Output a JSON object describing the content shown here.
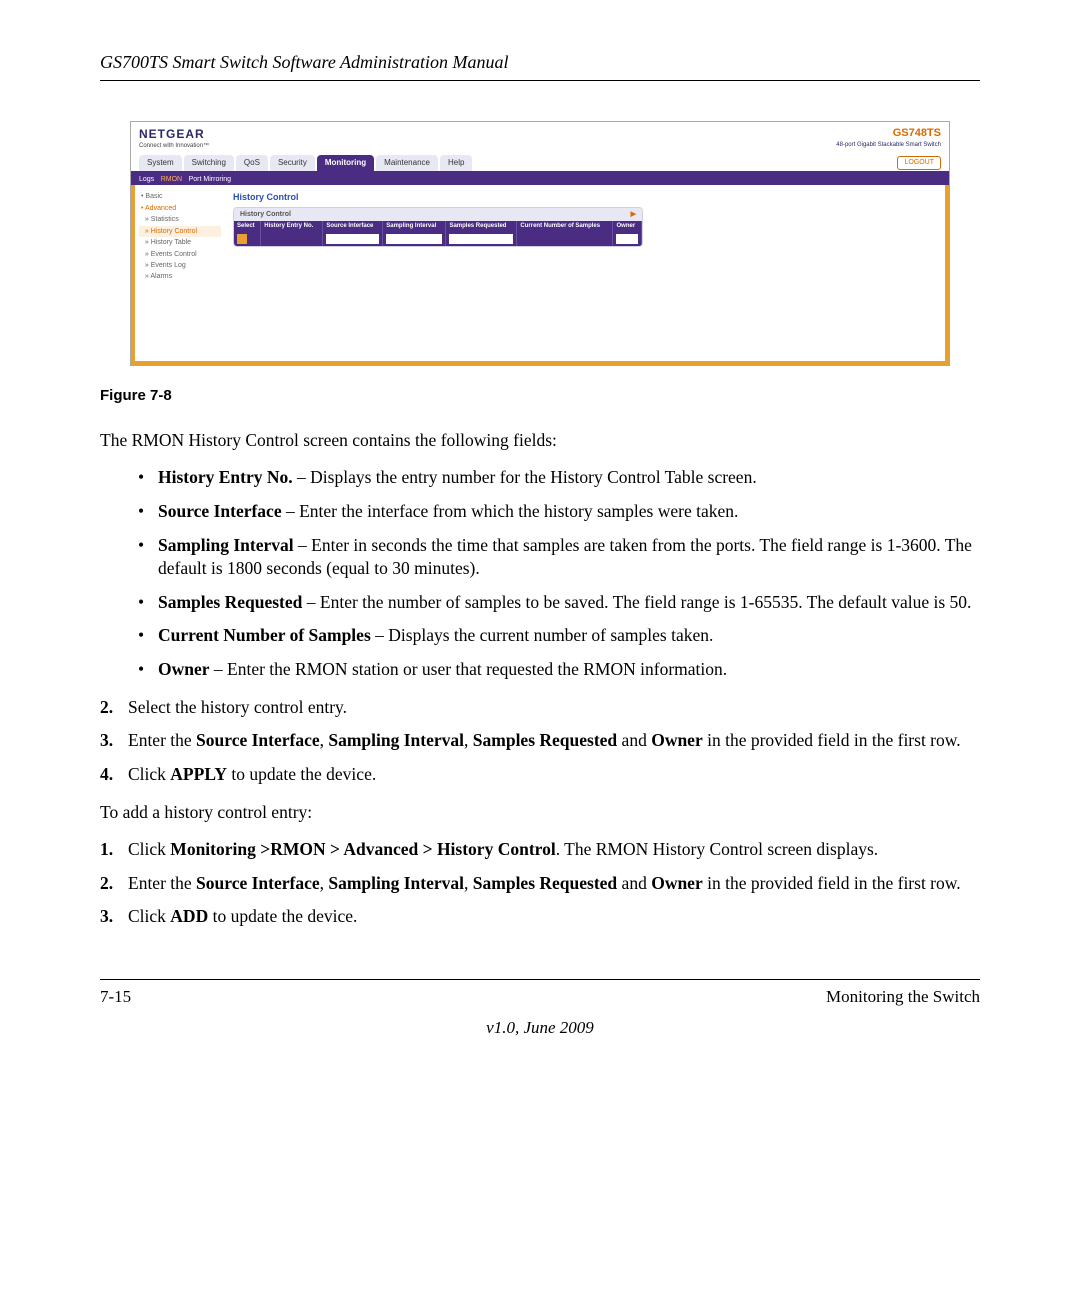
{
  "header": {
    "title": "GS700TS Smart Switch Software Administration Manual"
  },
  "screenshot": {
    "brand": "NETGEAR",
    "brand_tagline": "Connect with Innovation™",
    "model": "GS748TS",
    "model_tagline": "48-port Gigabit Stackable Smart Switch",
    "tabs": [
      "System",
      "Switching",
      "QoS",
      "Security",
      "Monitoring",
      "Maintenance",
      "Help"
    ],
    "active_tab": "Monitoring",
    "logout": "LOGOUT",
    "subtabs": [
      "Logs",
      "RMON",
      "Port Mirroring"
    ],
    "active_subtab": "RMON",
    "side_items": [
      "Basic",
      "Advanced",
      "Statistics",
      "History Control",
      "History Table",
      "Events Control",
      "Events Log",
      "Alarms"
    ],
    "side_active": "History Control",
    "section_title": "History Control",
    "panel_title": "History Control",
    "table_headers": [
      "Select",
      "History Entry No.",
      "Source Interface",
      "Sampling Interval",
      "Samples Requested",
      "Current Number of Samples",
      "Owner"
    ]
  },
  "figure_caption": "Figure 7-8",
  "intro": "The RMON History Control screen contains the following fields:",
  "fields": [
    {
      "term": "History Entry No.",
      "desc": " – Displays the entry number for the History Control Table screen."
    },
    {
      "term": "Source Interface",
      "desc": " – Enter the interface from which the history samples were taken."
    },
    {
      "term": "Sampling Interval",
      "desc": " – Enter in seconds the time that samples are taken from the ports. The field range is 1-3600. The default is 1800 seconds (equal to 30 minutes)."
    },
    {
      "term": "Samples Requested",
      "desc": " – Enter the number of samples to be saved. The field range is 1-65535. The default value is 50."
    },
    {
      "term": "Current Number of Samples",
      "desc": " – Displays the current number of samples taken."
    },
    {
      "term": "Owner",
      "desc": " – Enter the RMON station or user that requested the RMON information."
    }
  ],
  "steps_a": [
    {
      "n": "2.",
      "text_plain": "Select the history control entry."
    },
    {
      "n": "3.",
      "text_pre": "Enter the ",
      "b1": "Source Interface",
      "s1": ", ",
      "b2": "Sampling Interval",
      "s2": ", ",
      "b3": "Samples Requested",
      "s3": " and ",
      "b4": "Owner",
      "text_post": " in the provided field in the first row."
    },
    {
      "n": "4.",
      "text_pre": "Click ",
      "b1": "APPLY",
      "text_post": " to update the device."
    }
  ],
  "add_intro": "To add a history control entry:",
  "steps_b": [
    {
      "n": "1.",
      "text_pre": "Click ",
      "b1": "Monitoring >RMON > Advanced > History Control",
      "text_post": ". The RMON History Control screen displays."
    },
    {
      "n": "2.",
      "text_pre": "Enter the ",
      "b1": "Source Interface",
      "s1": ", ",
      "b2": "Sampling Interval",
      "s2": ", ",
      "b3": "Samples Requested",
      "s3": " and ",
      "b4": "Owner",
      "text_post": " in the provided field in the first row."
    },
    {
      "n": "3.",
      "text_pre": "Click ",
      "b1": "ADD",
      "text_post": " to update the device."
    }
  ],
  "footer": {
    "page": "7-15",
    "section": "Monitoring the Switch",
    "version": "v1.0, June 2009"
  }
}
